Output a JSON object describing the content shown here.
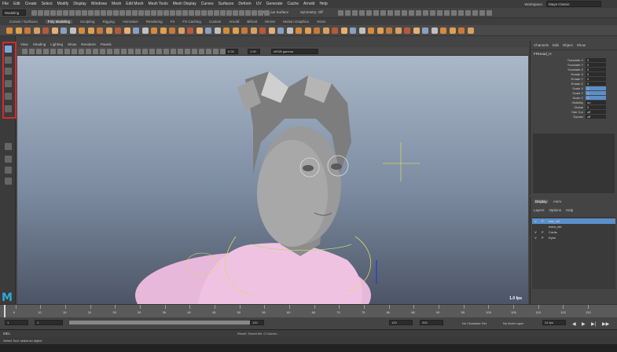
{
  "menu": [
    "File",
    "Edit",
    "Create",
    "Select",
    "Modify",
    "Display",
    "Windows",
    "Mesh",
    "Edit Mesh",
    "Mesh Tools",
    "Mesh Display",
    "Curves",
    "Surfaces",
    "Deform",
    "UV",
    "Generate",
    "Cache",
    "Arnold",
    "Help"
  ],
  "workspace": {
    "label": "Workspace:",
    "value": "Maya Classic"
  },
  "mode": "Modeling",
  "status": {
    "live_surface": "No Live Surface",
    "symmetry": "Symmetry: Off"
  },
  "shelf_tabs": [
    "Curves / Surfaces",
    "Poly Modeling",
    "Sculpting",
    "Rigging",
    "Animation",
    "Rendering",
    "FX",
    "FX Caching",
    "Custom",
    "Arnold",
    "Bifrost",
    "MASH",
    "Motion Graphics",
    "XGen"
  ],
  "active_shelf": "Poly Modeling",
  "panel_menu": [
    "View",
    "Shading",
    "Lighting",
    "Show",
    "Renderer",
    "Panels"
  ],
  "viewport": {
    "fps": "1.0 fps",
    "field1": "0.00",
    "field2": "1.00",
    "colorspace": "sRGB gamma"
  },
  "channel_box": {
    "tabs": [
      "Channels",
      "Edit",
      "Object",
      "Show"
    ],
    "object": "FRHead_H",
    "attrs": [
      {
        "n": "Translate X",
        "v": "0",
        "hi": false
      },
      {
        "n": "Translate Y",
        "v": "0",
        "hi": false
      },
      {
        "n": "Translate Z",
        "v": "0",
        "hi": false
      },
      {
        "n": "Rotate X",
        "v": "0",
        "hi": false
      },
      {
        "n": "Rotate Y",
        "v": "0",
        "hi": false
      },
      {
        "n": "Rotate Z",
        "v": "0",
        "hi": false
      },
      {
        "n": "Scale X",
        "v": "1",
        "hi": true
      },
      {
        "n": "Scale Y",
        "v": "1",
        "hi": true
      },
      {
        "n": "Scale Z",
        "v": "1",
        "hi": true
      },
      {
        "n": "Visibility",
        "v": "on",
        "hi": false
      },
      {
        "n": "Global",
        "v": "0",
        "hi": false
      },
      {
        "n": "Hair Cur",
        "v": "off",
        "hi": false
      },
      {
        "n": "Dynam",
        "v": "off",
        "hi": false
      }
    ]
  },
  "display": {
    "tabs": [
      "Display",
      "Anim"
    ],
    "menus": [
      "Layers",
      "Options",
      "Help"
    ],
    "layers": [
      {
        "name": "hair_ctrl",
        "v": "V",
        "p": "P",
        "sel": true
      },
      {
        "name": "extra_ctrl",
        "v": "",
        "p": "",
        "sel": false
      },
      {
        "name": "Cords",
        "v": "V",
        "p": "P",
        "sel": false
      },
      {
        "name": "Eyes",
        "v": "V",
        "p": "P",
        "sel": false
      }
    ]
  },
  "timeline": {
    "ticks": [
      "5",
      "10",
      "15",
      "20",
      "25",
      "30",
      "35",
      "40",
      "45",
      "50",
      "55",
      "60",
      "65",
      "70",
      "75",
      "80",
      "85",
      "90",
      "95",
      "100",
      "105",
      "110",
      "115",
      "120"
    ]
  },
  "range": {
    "start": "1",
    "start2": "1",
    "end1": "120",
    "end2": "120",
    "end3": "200",
    "char_set": "No Character Set",
    "anim_layer": "No Anim Layer",
    "fps": "24 fps"
  },
  "mel": {
    "label": "MEL",
    "result": "Result: Saved file: C:/Users/..."
  },
  "help": "Select Tool: select an object"
}
